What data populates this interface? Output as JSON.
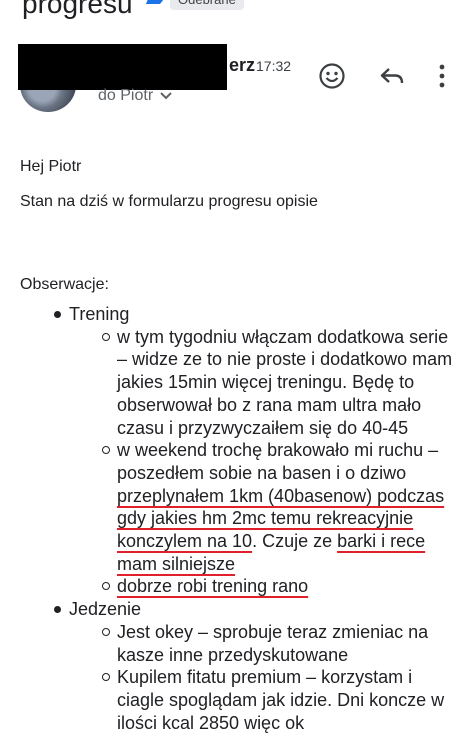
{
  "header": {
    "subject": "progresu",
    "label_badge": "Odebrane"
  },
  "message": {
    "sender_name_tail": "erz",
    "time": "17:32",
    "recipient": "do Piotr",
    "actions": {
      "emoji_icon": "emoji-reaction-icon",
      "reply_icon": "reply-icon",
      "more_icon": "more-vert-icon"
    }
  },
  "content": {
    "greeting": "Hej Piotr",
    "intro": "Stan na dziś w formularzu progresu opisie",
    "section_title": "Obserwacje:",
    "topics": [
      {
        "title": "Trening",
        "items": [
          {
            "parts": [
              {
                "text": "w tym tygodniu włączam dodatkowa serie – widze ze to nie proste i dodatkowo mam jakies 15min więcej treningu. Będę to obserwował bo z rana mam ultra mało czasu i przyzwyczaiłem się do 40-45"
              }
            ]
          },
          {
            "parts": [
              {
                "text": "w weekend trochę brakowało mi ruchu – poszedłem sobie na basen i o dziwo "
              },
              {
                "text": "przeplynałem 1km (40basenow) podczas gdy jakies hm 2mc temu rekreacyjnie konczylem na 10"
              },
              {
                "text": ". Czuje ze "
              },
              {
                "text": "barki i rece mam silniejsze"
              }
            ]
          },
          {
            "parts": [
              {
                "text": "dobrze robi trening rano"
              }
            ]
          }
        ]
      },
      {
        "title": "Jedzenie",
        "items": [
          {
            "parts": [
              {
                "text": "Jest okey – sprobuje teraz zmieniac na kasze inne przedyskutowane"
              }
            ]
          },
          {
            "parts": [
              {
                "text": "Kupilem fitatu premium – korzystam i ciagle spoglądam jak idzie. Dni koncze w ilości kcal 2850 więc ok"
              }
            ]
          }
        ]
      }
    ]
  },
  "colors": {
    "accent": "#1a73e8",
    "underline": "#e0202a",
    "text": "#202124"
  }
}
